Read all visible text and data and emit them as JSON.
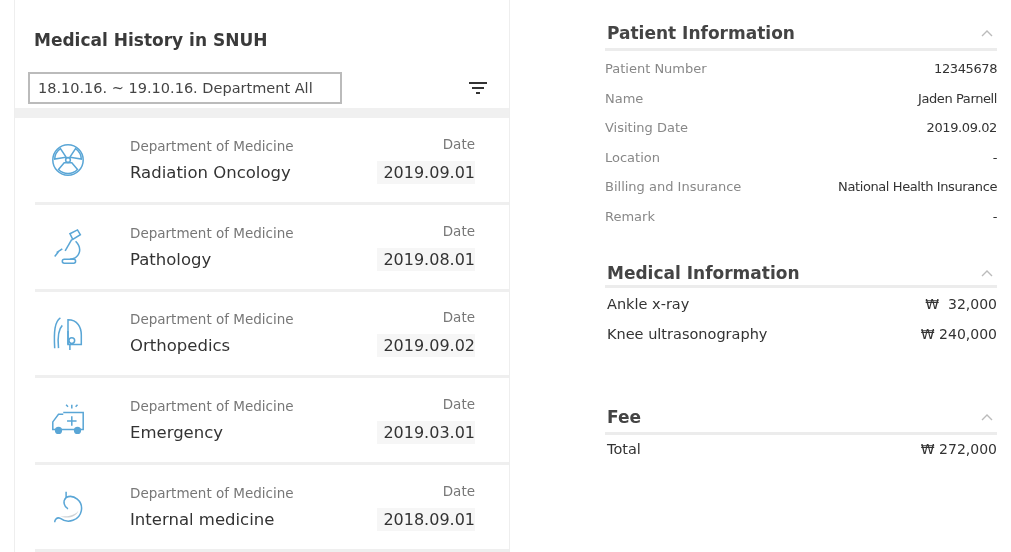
{
  "history": {
    "title": "Medical History in SNUH",
    "filter": "18.10.16. ~ 19.10.16. Department All",
    "records": [
      {
        "kind": "radiation",
        "department_label": "Department of Medicine",
        "department": "Radiation Oncology",
        "date_label": "Date",
        "date": "2019.09.01"
      },
      {
        "kind": "microscope",
        "department_label": "Department of Medicine",
        "department": "Pathology",
        "date_label": "Date",
        "date": "2019.08.01"
      },
      {
        "kind": "arm",
        "department_label": "Department of Medicine",
        "department": "Orthopedics",
        "date_label": "Date",
        "date": "2019.09.02"
      },
      {
        "kind": "ambulance",
        "department_label": "Department of Medicine",
        "department": "Emergency",
        "date_label": "Date",
        "date": "2019.03.01"
      },
      {
        "kind": "stomach",
        "department_label": "Department of Medicine",
        "department": "Internal medicine",
        "date_label": "Date",
        "date": "2018.09.01"
      }
    ]
  },
  "sections": [
    {
      "kind": "details",
      "title": "Patient Information",
      "expanded": true,
      "rows": [
        {
          "label": "Patient Number",
          "value": "12345678"
        },
        {
          "label": "Name",
          "value": "Jaden Parnell"
        },
        {
          "label": "Visiting Date",
          "value": "2019.09.02"
        },
        {
          "label": "Location",
          "value": "-"
        },
        {
          "label": "Billing and Insurance",
          "value": "National Health Insurance"
        },
        {
          "label": "Remark",
          "value": "-"
        }
      ]
    },
    {
      "kind": "items",
      "title": "Medical Information",
      "expanded": true,
      "rows": [
        {
          "label": "Ankle x-ray",
          "currency": "₩",
          "value": "32,000"
        },
        {
          "label": "Knee ultrasonography",
          "currency": "₩",
          "value": "240,000"
        }
      ]
    },
    {
      "kind": "total",
      "title": "Fee",
      "expanded": true,
      "rows": [
        {
          "label": "Total",
          "currency": "₩",
          "value": "272,000"
        }
      ]
    }
  ]
}
